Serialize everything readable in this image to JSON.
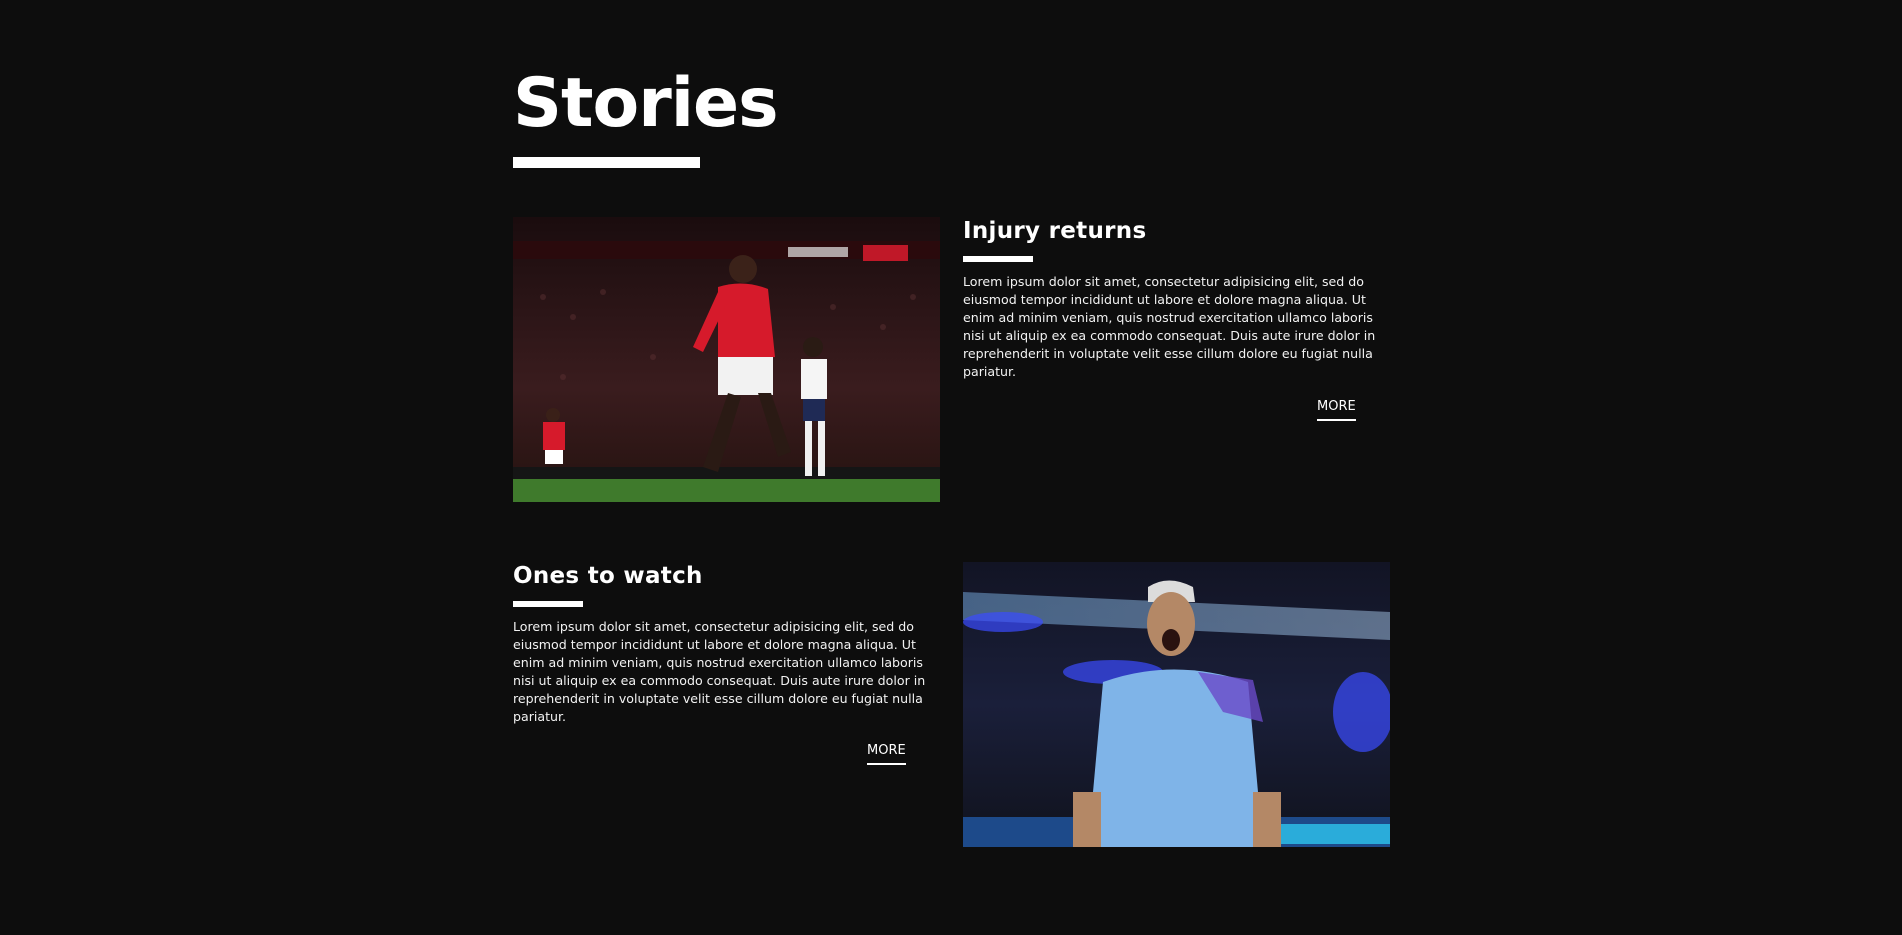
{
  "page": {
    "title": "Stories"
  },
  "stories": [
    {
      "heading": "Injury returns",
      "body": "Lorem ipsum dolor sit amet, consectetur adipisicing elit, sed do eiusmod tempor incididunt ut labore et dolore magna aliqua. Ut enim ad minim veniam, quis nostrud exercitation ullamco laboris nisi ut aliquip ex ea commodo consequat. Duis aute irure dolor in reprehenderit in voluptate velit esse cillum dolore eu fugiat nulla pariatur.",
      "more_label": "MORE",
      "image_alt": "Footballer in red kit running on pitch",
      "colors": {
        "kit": "#d61a2b",
        "pitch": "#3f7a2c",
        "crowd": "#2a1416"
      }
    },
    {
      "heading": "Ones to watch",
      "body": "Lorem ipsum dolor sit amet, consectetur adipisicing elit, sed do eiusmod tempor incididunt ut labore et dolore magna aliqua. Ut enim ad minim veniam, quis nostrud exercitation ullamco laboris nisi ut aliquip ex ea commodo consequat. Duis aute irure dolor in reprehenderit in voluptate velit esse cillum dolore eu fugiat nulla pariatur.",
      "more_label": "MORE",
      "image_alt": "Footballer in sky blue kit celebrating",
      "colors": {
        "kit": "#7fb4e8",
        "stand": "#1a1f3a",
        "lights": "#3a4cff"
      }
    }
  ]
}
